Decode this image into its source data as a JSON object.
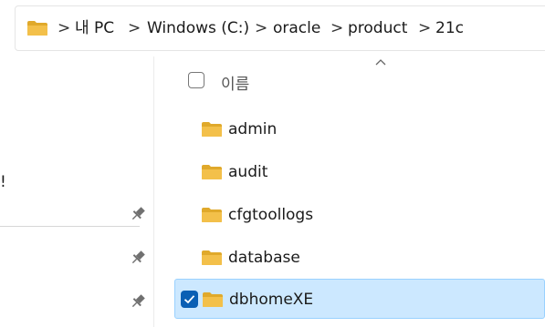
{
  "address_bar": {
    "segments": [
      "내 PC",
      "Windows (C:)",
      "oracle",
      "product",
      "21c"
    ],
    "separator": ">"
  },
  "nav_pane": {
    "truncated_text": "!"
  },
  "file_list": {
    "column_header": "이름",
    "sort": "ascending",
    "items": [
      {
        "name": "admin",
        "selected": false
      },
      {
        "name": "audit",
        "selected": false
      },
      {
        "name": "cfgtoollogs",
        "selected": false
      },
      {
        "name": "database",
        "selected": false
      },
      {
        "name": "dbhomeXE",
        "selected": true
      }
    ]
  },
  "colors": {
    "folder": "#f3c04a",
    "folder_dark": "#e0a92b",
    "selection_bg": "#cce8ff",
    "selection_border": "#99d1ff",
    "checkbox_checked": "#0a5fb4"
  }
}
